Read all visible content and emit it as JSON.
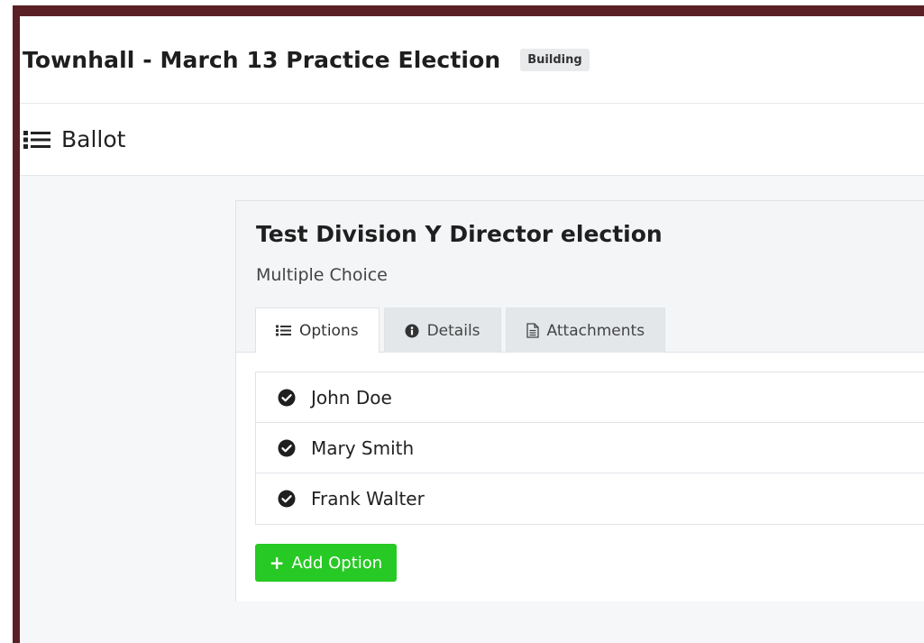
{
  "header": {
    "title": "Townhall - March 13 Practice Election",
    "status": "Building"
  },
  "section": {
    "title": "Ballot",
    "icon": "list-icon"
  },
  "question": {
    "title": "Test Division Y Director election",
    "type": "Multiple Choice"
  },
  "tabs": [
    {
      "label": "Options",
      "icon": "list-icon",
      "active": true
    },
    {
      "label": "Details",
      "icon": "info-icon",
      "active": false
    },
    {
      "label": "Attachments",
      "icon": "document-icon",
      "active": false
    }
  ],
  "options": [
    {
      "label": "John Doe"
    },
    {
      "label": "Mary Smith"
    },
    {
      "label": "Frank Walter"
    }
  ],
  "add_option": {
    "label": "Add Option"
  },
  "colors": {
    "frame": "#5b1f26",
    "add_button": "#27c924"
  }
}
